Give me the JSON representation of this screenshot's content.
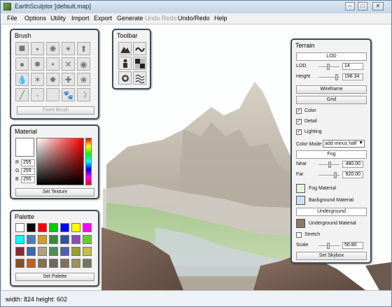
{
  "window": {
    "title": "EarthSculptor [default.map]",
    "min_icon": "minimize-icon",
    "max_icon": "maximize-icon",
    "close_icon": "close-icon"
  },
  "menu": [
    "File",
    "Options",
    "Utility",
    "Import",
    "Export",
    "Generate",
    "Undo Redo",
    "Undo/Redo",
    "Help"
  ],
  "menu_disabled": [
    "Undo Redo"
  ],
  "status": "width: 824 height: 602",
  "brush": {
    "title": "Brush",
    "icons": [
      "square-brush-icon",
      "rounded-square-brush-icon",
      "spray-brush-icon",
      "splatter-brush-icon",
      "up-arrow-icon",
      "circle-brush-icon",
      "star-burst-brush-icon",
      "small-dot-brush-icon",
      "cross-brush-icon",
      "soft-circle-brush-icon",
      "drop-brush-icon",
      "star-brush-icon",
      "large-star-brush-icon",
      "cross-lines-brush-icon",
      "blob-brush-icon",
      "line-brush-icon",
      "dash-brush-icon",
      "blank-brush-icon",
      "paw-brush-icon",
      "crescent-brush-icon"
    ],
    "fixed_label": "Fixed Brush"
  },
  "toolbar": {
    "title": "Toolbar",
    "icons": [
      "mountain-icon",
      "wave-arrow-icon",
      "figure-icon",
      "checker-icon",
      "sun-icon",
      "water-waves-icon"
    ]
  },
  "material": {
    "title": "Material",
    "r_label": "R",
    "g_label": "G",
    "b_label": "B",
    "r": "255",
    "g": "255",
    "b": "255",
    "set_texture": "Set Texture",
    "current_color": "#ffffff"
  },
  "palette": {
    "title": "Palette",
    "set_palette": "Set Palette",
    "colors": [
      "#ffffff",
      "#000000",
      "#ff0000",
      "#00cc00",
      "#0000ff",
      "#ffff00",
      "#ff00ff",
      "#00ffff",
      "#4a7cc4",
      "#d4a020",
      "#3a8c3a",
      "#3050a0",
      "#8a4ab8",
      "#66cc33",
      "#8a2a2a",
      "#3a6ab0",
      "#b0a080",
      "#4a9050",
      "#5060b0",
      "#9a9a30",
      "#c0c048",
      "#8a5020",
      "#c06020",
      "#8a7050",
      "#6a6a5a",
      "#807060",
      "#a09060",
      "#707860"
    ]
  },
  "terrain": {
    "title": "Terrain",
    "lod_header": "LOD",
    "lod_label": "LOD",
    "lod_value": "14",
    "height_label": "Height",
    "height_value": "198.34",
    "wireframe": "Wireframe",
    "grid": "Grid",
    "color_label": "Color",
    "detail_label": "Detail",
    "lighting_label": "Lighting",
    "color_mode_label": "Color Mode",
    "color_mode_value": "add minus half",
    "fog_header": "Fog",
    "near_label": "Near",
    "near_value": "480.00",
    "far_label": "Far",
    "far_value": "920.00",
    "fog_material": "Fog Material",
    "background_material": "Background Material",
    "underground_header": "Underground",
    "underground_material": "Underground Material",
    "stretch_label": "Stretch",
    "scale_label": "Scale",
    "scale_value": "56.80",
    "set_skybox": "Set Skybox",
    "fog_color": "#e4f4dc",
    "background_color": "#cce0f0",
    "underground_color": "#8a7a6a"
  }
}
